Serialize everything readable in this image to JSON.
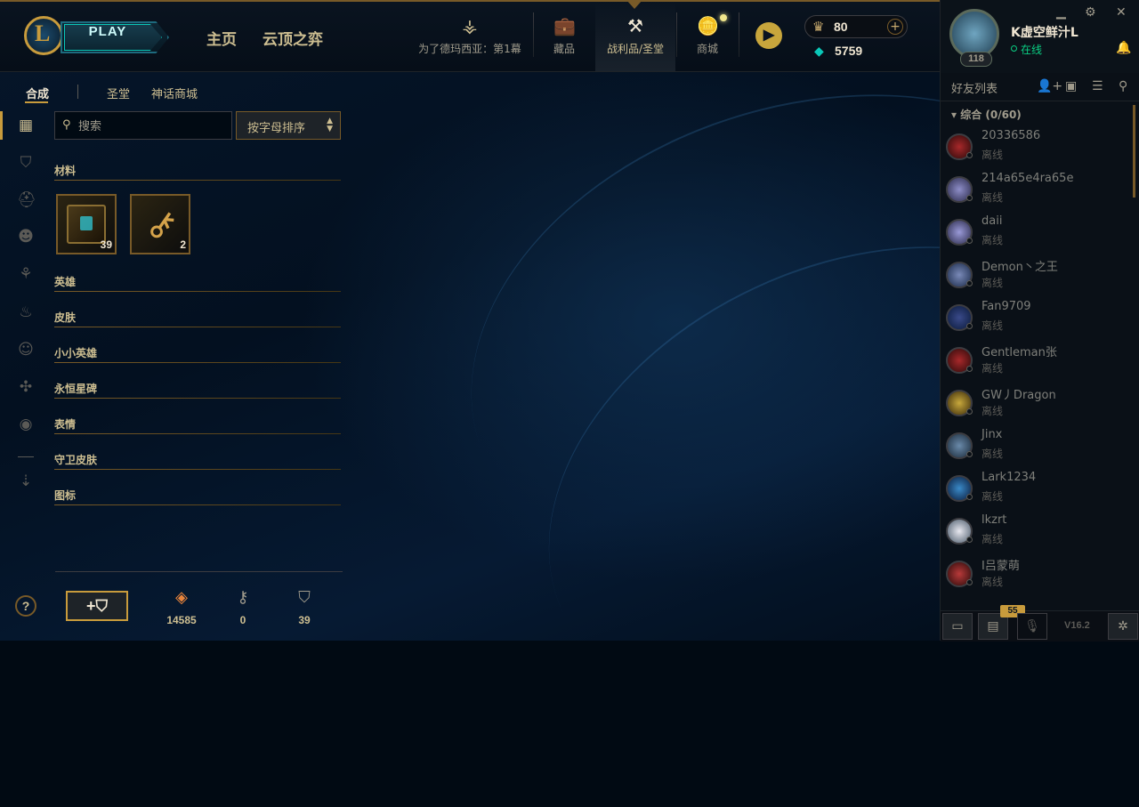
{
  "topbar": {
    "play_label": "PLAY",
    "home": "主页",
    "tft": "云顶之弈",
    "nav": [
      {
        "label": "为了德玛西亚：第1幕",
        "icon": "pass-icon"
      },
      {
        "label": "藏品",
        "icon": "collection-icon"
      },
      {
        "label": "战利品/圣堂",
        "icon": "loot-icon"
      },
      {
        "label": "商城",
        "icon": "store-icon"
      }
    ],
    "rp": "80",
    "be": "5759"
  },
  "user": {
    "name": "K虚空鲜汁L",
    "status": "在线",
    "level": "118"
  },
  "friends": {
    "title": "好友列表",
    "group": "综合 (0/60)",
    "list": [
      {
        "name": "20336586",
        "status": "离线"
      },
      {
        "name": "214a65e4ra65e",
        "status": "离线"
      },
      {
        "name": "daii",
        "status": "离线"
      },
      {
        "name": "Demon丶之王",
        "status": "离线"
      },
      {
        "name": "Fan9709",
        "status": "离线"
      },
      {
        "name": "Gentleman张",
        "status": "离线"
      },
      {
        "name": "GW丿Dragon",
        "status": "离线"
      },
      {
        "name": "Jinx",
        "status": "离线"
      },
      {
        "name": "Lark1234",
        "status": "离线"
      },
      {
        "name": "lkzrt",
        "status": "离线"
      },
      {
        "name": "I吕蒙萌",
        "status": "离线"
      }
    ],
    "footer_badge": "55",
    "version": "V16.2"
  },
  "loot": {
    "tabs": [
      "合成",
      "圣堂",
      "神话商城"
    ],
    "search_placeholder": "搜索",
    "sort_label": "按字母排序",
    "categories": [
      "材料",
      "英雄",
      "皮肤",
      "小小英雄",
      "永恒星碑",
      "表情",
      "守卫皮肤",
      "图标"
    ],
    "items": [
      {
        "name": "chest",
        "count": "39"
      },
      {
        "name": "key",
        "count": "2"
      }
    ],
    "stats": [
      {
        "icon": "orange-essence-icon",
        "value": "14585"
      },
      {
        "icon": "key-fragment-icon",
        "value": "0"
      },
      {
        "icon": "chest-icon",
        "value": "39"
      }
    ],
    "help": "?"
  },
  "colors": {
    "gold": "#c89b3c",
    "teal": "#0ac8b9",
    "online": "#0acf83"
  }
}
